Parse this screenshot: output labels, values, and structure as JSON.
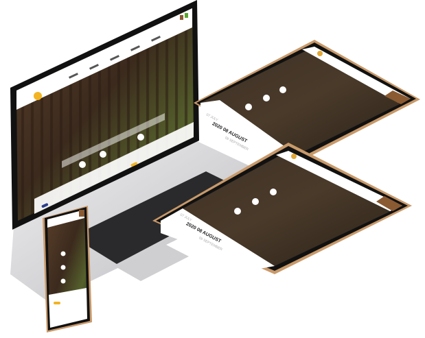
{
  "scene": {
    "devices": [
      "laptop",
      "tablet-top",
      "tablet-bottom",
      "phone"
    ],
    "colors": {
      "forest_dark": "#3a2a1e",
      "forest_green": "#4f5a2a",
      "header_white": "#ffffff",
      "accent_blue": "#2b3f8c",
      "accent_yellow": "#f2b422",
      "accent_brown": "#8a5a32",
      "bezel": "#1a1a1a",
      "tablet_frame_gold": "#c8996a",
      "laptop_silver": "#d9d9db"
    }
  },
  "tablet_top": {
    "month_prev": "07 JULY",
    "month_current": "2020 08 AUGUST",
    "month_next": "09 SEPTEMBER",
    "menu_icon": "hamburger-icon"
  },
  "tablet_bottom": {
    "month_prev": "07 JULY",
    "month_current": "2020 08 AUGUST",
    "month_next": "09 SEPTEMBER",
    "menu_icon": "hamburger-icon"
  }
}
